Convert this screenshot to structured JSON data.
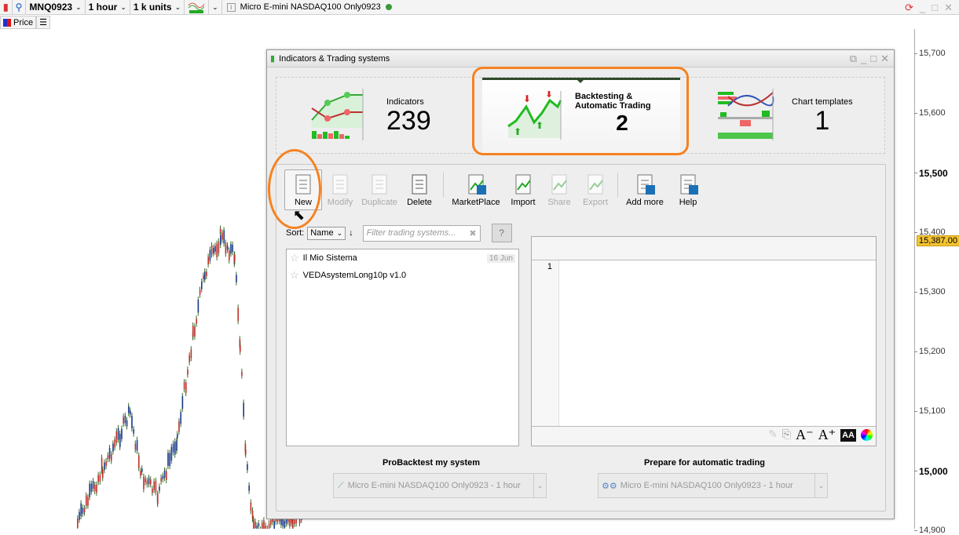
{
  "topbar": {
    "symbol": "MNQ0923",
    "timeframe": "1 hour",
    "units": "1 k units",
    "title": "Micro E-mini NASDAQ100 Only0923"
  },
  "subbar": {
    "price_label": "Price"
  },
  "price_axis": {
    "ticks": [
      "15,700",
      "15,600",
      "15,500",
      "15,400",
      "15,300",
      "15,200",
      "15,100",
      "15,000",
      "14,900"
    ],
    "current_price": "15,387.00"
  },
  "dialog": {
    "title": "Indicators & Trading systems",
    "categories": [
      {
        "label": "Indicators",
        "count": "239"
      },
      {
        "label": "Backtesting & Automatic Trading",
        "count": "2"
      },
      {
        "label": "Chart templates",
        "count": "1"
      }
    ],
    "toolbar": [
      "New",
      "Modify",
      "Duplicate",
      "Delete",
      "MarketPlace",
      "Import",
      "Share",
      "Export",
      "Add more",
      "Help"
    ],
    "sort_label": "Sort:",
    "sort_value": "Name",
    "filter_placeholder": "Filter trading systems...",
    "systems": [
      {
        "name": "Il Mio Sistema",
        "date": "16 Jun"
      },
      {
        "name": "VEDAsystemLong10p v1.0",
        "date": ""
      }
    ],
    "editor_line": "1",
    "backtest_label": "ProBacktest my system",
    "backtest_value": "Micro E-mini NASDAQ100 Only0923 - 1 hour",
    "auto_label": "Prepare for automatic trading",
    "auto_value": "Micro E-mini NASDAQ100 Only0923 - 1 hour"
  },
  "colors": {
    "accent": "#f58220",
    "up": "#1a3a8a",
    "down": "#c0302a"
  }
}
